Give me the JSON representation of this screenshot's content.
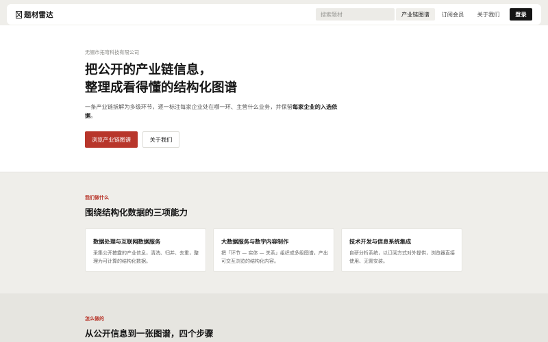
{
  "header": {
    "logo_text": "题材雷达",
    "search_placeholder": "搜索题材",
    "nav": [
      "产业链图谱",
      "订阅会员",
      "关于我们"
    ],
    "login_label": "登录"
  },
  "hero": {
    "company": "无锡市拓穹科技有限公司",
    "title_line1": "把公开的产业链信息，",
    "title_line2": "整理成看得懂的结构化图谱",
    "desc_prefix": "一条产业链拆解为多级环节，逐一标注每家企业处在哪一环、主营什么业务，并保留",
    "desc_bold": "每家企业的入选依据",
    "desc_suffix": "。",
    "primary_button": "浏览产业链图谱",
    "secondary_button": "关于我们"
  },
  "capabilities": {
    "eyebrow": "我们做什么",
    "title": "围绕结构化数据的三项能力",
    "cards": [
      {
        "title": "数据处理与互联网数据服务",
        "desc": "采集公开披露的产业信息，清洗、归并、去重，整理为可计算的结构化数据。"
      },
      {
        "title": "大数据服务与数字内容制作",
        "desc": "把「环节 — 实体 — 关系」组织成多级图谱，产出可交互浏览的结构化内容。"
      },
      {
        "title": "技术开发与信息系统集成",
        "desc": "自研分析系统，以订阅方式对外提供，浏览器直接使用、无需安装。"
      }
    ]
  },
  "steps": {
    "eyebrow": "怎么做的",
    "title": "从公开信息到一张图谱，四个步骤"
  },
  "colors": {
    "accent": "#b8362b",
    "dark": "#141414",
    "page_bg": "#efeeea"
  }
}
